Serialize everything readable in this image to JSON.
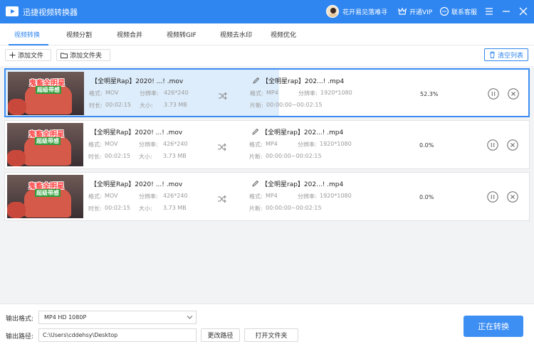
{
  "window": {
    "title": "迅捷视频转换器",
    "user_name": "花开易见落难寻",
    "vip_label": "开通VIP",
    "service_label": "联系客服"
  },
  "tabs": [
    {
      "label": "视频转换",
      "active": true
    },
    {
      "label": "视频分割"
    },
    {
      "label": "视频合并"
    },
    {
      "label": "视频转GIF"
    },
    {
      "label": "视频去水印"
    },
    {
      "label": "视频优化"
    }
  ],
  "toolbar": {
    "add_file_label": "添加文件",
    "add_folder_label": "添加文件夹",
    "clear_list_label": "清空列表"
  },
  "labels": {
    "format": "格式:",
    "resolution": "分辨率:",
    "duration": "时长:",
    "size": "大小:",
    "clip": "片断:"
  },
  "thumbnail_text": {
    "line1": "鬼畜全明星",
    "line2": "超级带感"
  },
  "files": [
    {
      "source_name": "【全明星Rap】2020!  ...!  .mov",
      "source_format": "MOV",
      "source_resolution": "426*240",
      "source_duration": "00:02:15",
      "source_size": "3.73 MB",
      "output_name": "【全明星rap】202...!  .mp4",
      "output_format": "MP4",
      "output_resolution": "1920*1080",
      "output_clip": "00:00:00~00:02:15",
      "progress": "52.3%",
      "progress_fraction": 0.523,
      "active": true
    },
    {
      "source_name": "【全明星Rap】2020!  ...!  .mov",
      "source_format": "MOV",
      "source_resolution": "426*240",
      "source_duration": "00:02:15",
      "source_size": "3.73 MB",
      "output_name": "【全明星rap】202...!  .mp4",
      "output_format": "MP4",
      "output_resolution": "1920*1080",
      "output_clip": "00:00:00~00:02:15",
      "progress": "0.0%",
      "progress_fraction": 0,
      "active": false
    },
    {
      "source_name": "【全明星Rap】2020!  ...!  .mov",
      "source_format": "MOV",
      "source_resolution": "426*240",
      "source_duration": "00:02:15",
      "source_size": "3.73 MB",
      "output_name": "【全明星rap】202...!  .mp4",
      "output_format": "MP4",
      "output_resolution": "1920*1080",
      "output_clip": "00:00:00~00:02:15",
      "progress": "0.0%",
      "progress_fraction": 0,
      "active": false
    }
  ],
  "bottom": {
    "format_label": "输出格式:",
    "format_value": "MP4  HD 1080P",
    "path_label": "输出路径:",
    "path_value": "C:\\Users\\cddehsy\\Desktop",
    "change_path_label": "更改路径",
    "open_folder_label": "打开文件夹",
    "convert_label": "正在转换"
  },
  "colors": {
    "accent": "#2f86f0",
    "progress_fill": "#deedfb",
    "list_background": "#f2f3f5"
  },
  "icons": [
    "app-logo-icon",
    "vip-icon",
    "customer-service-icon",
    "menu-icon",
    "minimize-icon",
    "close-icon",
    "plus-icon",
    "folder-icon",
    "trash-icon",
    "shuffle-icon",
    "edit-icon",
    "pause-icon",
    "remove-icon",
    "chevron-down-icon"
  ]
}
